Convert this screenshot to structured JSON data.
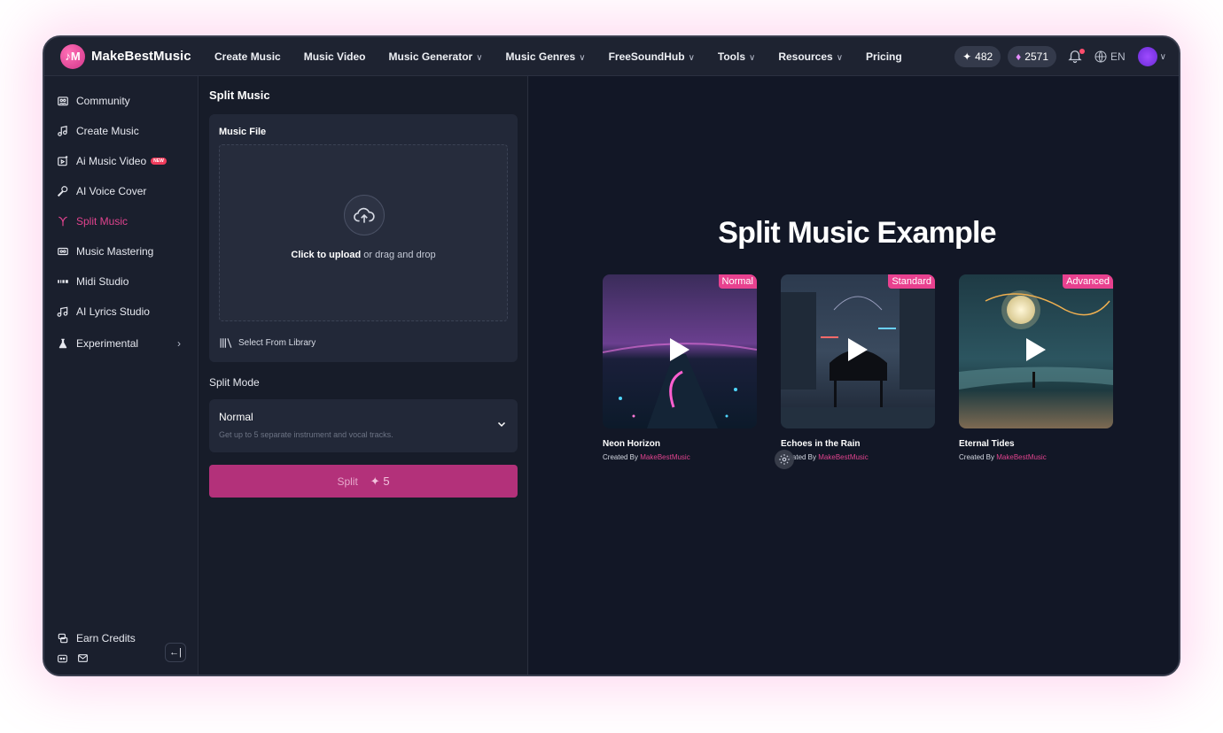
{
  "brand": {
    "name": "MakeBestMusic",
    "mark": "♪M"
  },
  "nav": [
    {
      "label": "Create Music",
      "dropdown": false
    },
    {
      "label": "Music Video",
      "dropdown": false
    },
    {
      "label": "Music Generator",
      "dropdown": true
    },
    {
      "label": "Music Genres",
      "dropdown": true
    },
    {
      "label": "FreeSoundHub",
      "dropdown": true
    },
    {
      "label": "Tools",
      "dropdown": true
    },
    {
      "label": "Resources",
      "dropdown": true
    },
    {
      "label": "Pricing",
      "dropdown": false
    }
  ],
  "header": {
    "credits": "482",
    "gems": "2571",
    "lang": "EN",
    "has_notification": true
  },
  "sidebar": {
    "items": [
      {
        "label": "Community",
        "icon": "community-icon"
      },
      {
        "label": "Create Music",
        "icon": "music-note-icon"
      },
      {
        "label": "Ai Music Video",
        "icon": "video-icon",
        "badge": "NEW"
      },
      {
        "label": "AI Voice Cover",
        "icon": "microphone-icon"
      },
      {
        "label": "Split Music",
        "icon": "split-icon",
        "active": true
      },
      {
        "label": "Music Mastering",
        "icon": "mastering-icon"
      },
      {
        "label": "Midi Studio",
        "icon": "midi-icon"
      },
      {
        "label": "AI Lyrics Studio",
        "icon": "lyrics-icon"
      },
      {
        "label": "Experimental",
        "icon": "flask-icon",
        "has_arrow": true
      }
    ],
    "earn_credits": "Earn Credits",
    "collapse_glyph": "←|"
  },
  "form": {
    "title": "Split Music",
    "file_label": "Music File",
    "upload_strong": "Click to upload",
    "upload_rest": " or drag and drop",
    "library": "Select From Library",
    "mode_label": "Split Mode",
    "mode_value": "Normal",
    "mode_desc": "Get up to 5 separate instrument and vocal tracks.",
    "split_label": "Split",
    "split_cost": "5"
  },
  "examples": {
    "title": "Split Music Example",
    "created_by": "Created By ",
    "items": [
      {
        "title": "Neon Horizon",
        "badge": "Normal",
        "author": "MakeBestMusic"
      },
      {
        "title": "Echoes in the Rain",
        "badge": "Standard",
        "author": "MakeBestMusic"
      },
      {
        "title": "Eternal Tides",
        "badge": "Advanced",
        "author": "MakeBestMusic"
      }
    ]
  },
  "colors": {
    "accent": "#e0438e",
    "button": "#b3317a",
    "background": "#131826"
  }
}
